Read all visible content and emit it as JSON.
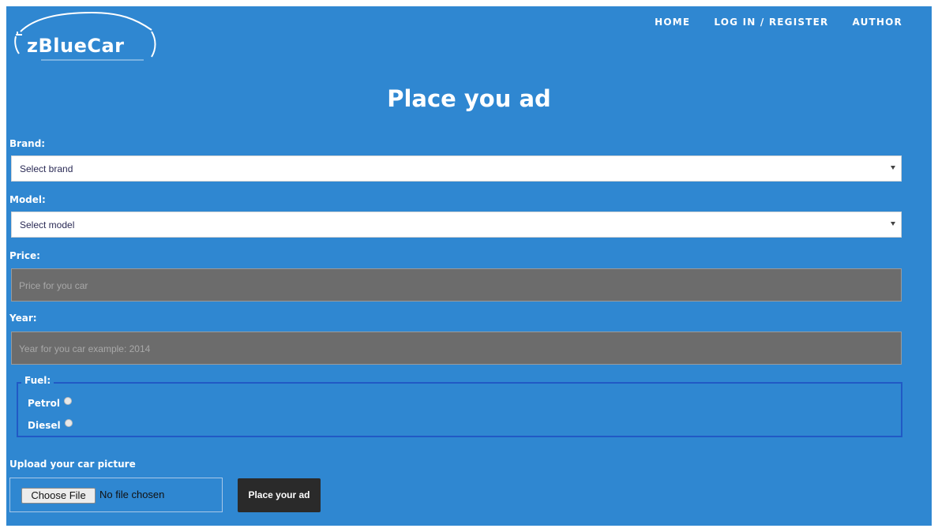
{
  "brand": {
    "name": "zBlueCar"
  },
  "nav": {
    "items": [
      "HOME",
      "LOG IN / REGISTER",
      "AUTHOR"
    ]
  },
  "form": {
    "title": "Place you ad",
    "brand_label": "Brand:",
    "brand_selected": "Select brand",
    "model_label": "Model:",
    "model_selected": "Select model",
    "price_label": "Price:",
    "price_placeholder": "Price for you car",
    "year_label": "Year:",
    "year_placeholder": "Year for you car example: 2014",
    "fuel_legend": "Fuel:",
    "fuel_options": [
      "Petrol",
      "Diesel"
    ],
    "upload_label": "Upload your car picture",
    "choose_file_label": "Choose File",
    "file_status": "No file chosen",
    "submit_label": "Place your ad"
  },
  "colors": {
    "background": "#2f87d1",
    "submit_button": "#2a2a2a",
    "input_fill": "#6c6c6c",
    "fieldset_border": "#2159c5"
  }
}
